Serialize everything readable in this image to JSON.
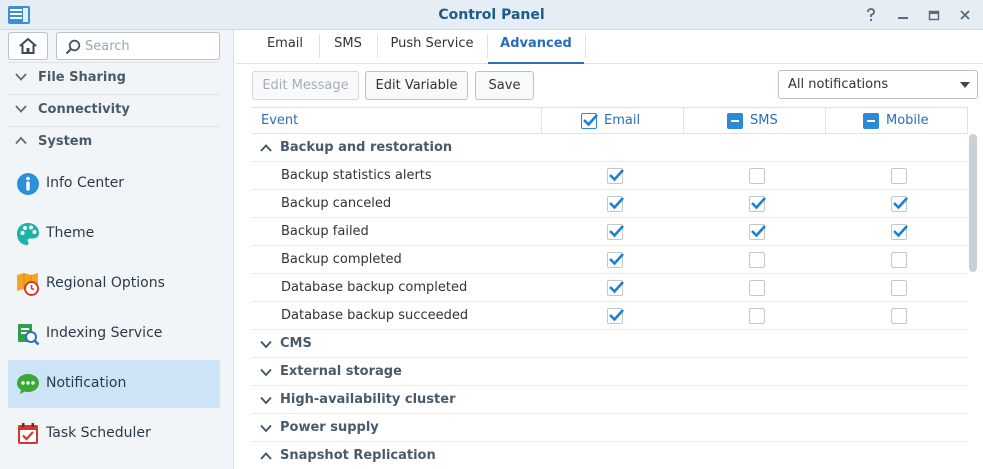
{
  "window": {
    "title": "Control Panel"
  },
  "sidebar": {
    "search_placeholder": "Search",
    "sections": [
      {
        "label": "File Sharing",
        "expanded": false
      },
      {
        "label": "Connectivity",
        "expanded": false
      },
      {
        "label": "System",
        "expanded": true
      }
    ],
    "items": [
      {
        "label": "Info Center",
        "icon": "info-icon"
      },
      {
        "label": "Theme",
        "icon": "palette-icon"
      },
      {
        "label": "Regional Options",
        "icon": "regional-clock-icon"
      },
      {
        "label": "Indexing Service",
        "icon": "indexing-icon"
      },
      {
        "label": "Notification",
        "icon": "chat-bubble-icon",
        "active": true
      },
      {
        "label": "Task Scheduler",
        "icon": "calendar-check-icon"
      }
    ]
  },
  "tabs": [
    "Email",
    "SMS",
    "Push Service",
    "Advanced"
  ],
  "active_tab": "Advanced",
  "toolbar": {
    "edit_message": "Edit Message",
    "edit_variable": "Edit Variable",
    "save": "Save",
    "filter_value": "All notifications"
  },
  "table": {
    "columns": [
      "Event",
      "Email",
      "SMS",
      "Mobile"
    ],
    "header_state": {
      "email": "checked",
      "sms": "partial",
      "mobile": "partial"
    },
    "groups": [
      {
        "label": "Backup and restoration",
        "expanded": true
      },
      {
        "label": "CMS",
        "expanded": false
      },
      {
        "label": "External storage",
        "expanded": false
      },
      {
        "label": "High-availability cluster",
        "expanded": false
      },
      {
        "label": "Power supply",
        "expanded": false
      },
      {
        "label": "Snapshot Replication",
        "expanded": true
      }
    ],
    "rows": [
      {
        "label": "Backup statistics alerts",
        "email": true,
        "sms": false,
        "mobile": false
      },
      {
        "label": "Backup canceled",
        "email": true,
        "sms": true,
        "mobile": true
      },
      {
        "label": "Backup failed",
        "email": true,
        "sms": true,
        "mobile": true
      },
      {
        "label": "Backup completed",
        "email": true,
        "sms": false,
        "mobile": false
      },
      {
        "label": "Database backup completed",
        "email": true,
        "sms": false,
        "mobile": false
      },
      {
        "label": "Database backup succeeded",
        "email": true,
        "sms": false,
        "mobile": false
      }
    ]
  },
  "colors": {
    "accent": "#2a6ebb",
    "check": "#1e7fd6",
    "active_bg": "#cde4f7"
  }
}
